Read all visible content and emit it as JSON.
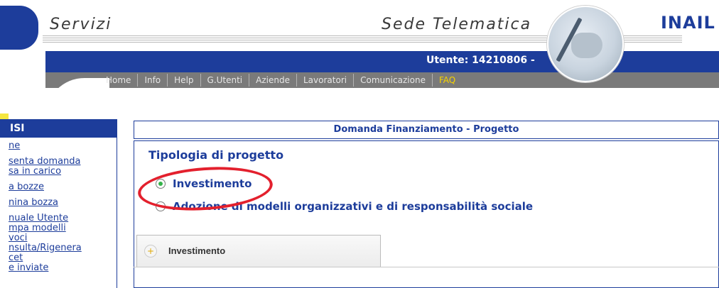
{
  "header": {
    "services_title": "Servizi",
    "site_title": "Sede Telematica",
    "brand": "INAIL",
    "user_label": "Utente: 14210806 -"
  },
  "nav": {
    "items": [
      {
        "label": "Home",
        "active": false
      },
      {
        "label": "Info",
        "active": false
      },
      {
        "label": "Help",
        "active": false
      },
      {
        "label": "G.Utenti",
        "active": false
      },
      {
        "label": "Aziende",
        "active": false
      },
      {
        "label": "Lavoratori",
        "active": false
      },
      {
        "label": "Comunicazione",
        "active": false
      },
      {
        "label": "FAQ",
        "active": true
      }
    ]
  },
  "left_menu": {
    "title": "ISI",
    "items": [
      "ne",
      "senta domanda",
      "sa in carico",
      "a bozze",
      "nina bozza",
      "nuale Utente",
      "mpa modelli",
      "voci",
      "nsulta/Rigenera",
      "cet",
      "e inviate"
    ]
  },
  "main": {
    "header_title": "Domanda Finanziamento - Progetto",
    "section_heading": "Tipologia di progetto",
    "options": [
      {
        "label": "Investimento",
        "checked": true
      },
      {
        "label": "Adozione di modelli organizzativi e di responsabilità sociale",
        "checked": false
      }
    ],
    "tab_label": "Investimento",
    "tab_icon": "+"
  },
  "colors": {
    "brand_blue": "#1d3d9b",
    "accent_yellow": "#f4e640",
    "annotation_red": "#e3202d",
    "radio_green": "#34b34a"
  }
}
